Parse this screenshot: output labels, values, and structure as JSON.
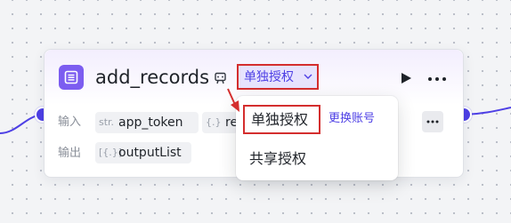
{
  "node": {
    "title": "add_records",
    "auth_mode_label": "单独授权",
    "inputs_label": "输入",
    "outputs_label": "输出",
    "inputs": [
      {
        "type": "str.",
        "name": "app_token"
      },
      {
        "type": "{.}",
        "name": "re"
      }
    ],
    "outputs": [
      {
        "type": "[{.}]",
        "name": "outputList"
      }
    ]
  },
  "auth_menu": {
    "options": [
      {
        "label": "单独授权"
      },
      {
        "label": "共享授权"
      }
    ],
    "switch_account_label": "更换账号"
  },
  "colors": {
    "accent": "#4e40e5",
    "highlight_border": "#d42e2e",
    "node_icon_bg": "#7c5df0"
  },
  "icons": [
    "list-app-icon",
    "edit-icon",
    "chevron-down-icon",
    "run-icon",
    "more-icon"
  ]
}
